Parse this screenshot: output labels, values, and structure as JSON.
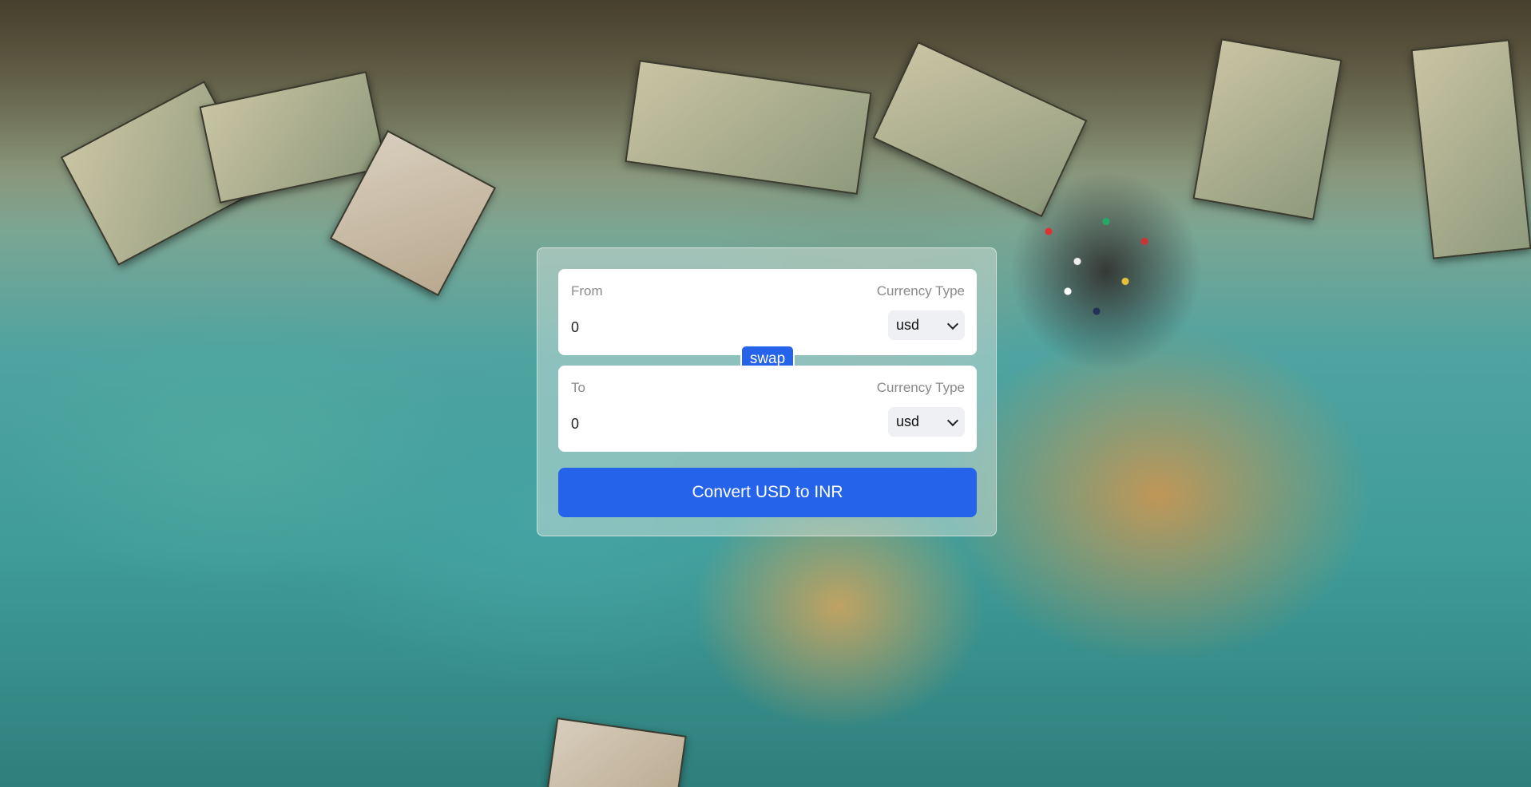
{
  "converter": {
    "from": {
      "label": "From",
      "currency_label": "Currency Type",
      "amount": "0",
      "currency": "usd"
    },
    "to": {
      "label": "To",
      "currency_label": "Currency Type",
      "amount": "0",
      "currency": "usd"
    },
    "swap_label": "swap",
    "convert_label": "Convert USD to INR"
  },
  "colors": {
    "accent": "#2563eb",
    "panel": "#ffffff",
    "muted_text": "#8a8a8a"
  },
  "icons": {
    "select_arrow": "chevron-down-icon"
  }
}
